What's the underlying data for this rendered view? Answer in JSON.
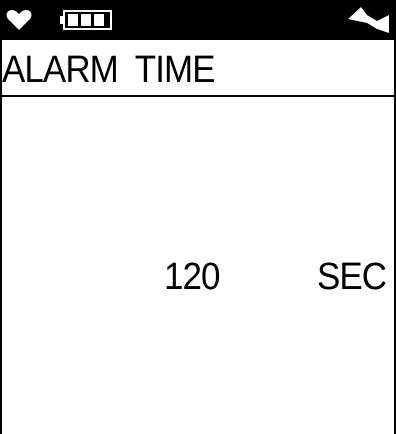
{
  "status_bar": {
    "icons": [
      "heart-icon",
      "battery-icon",
      "bowtie-icon"
    ],
    "battery_level": 1.0
  },
  "title": {
    "text": "ALARM  TIME"
  },
  "setting": {
    "value": "120",
    "unit": "SEC"
  },
  "colors": {
    "foreground": "#000000",
    "background": "#ffffff"
  }
}
